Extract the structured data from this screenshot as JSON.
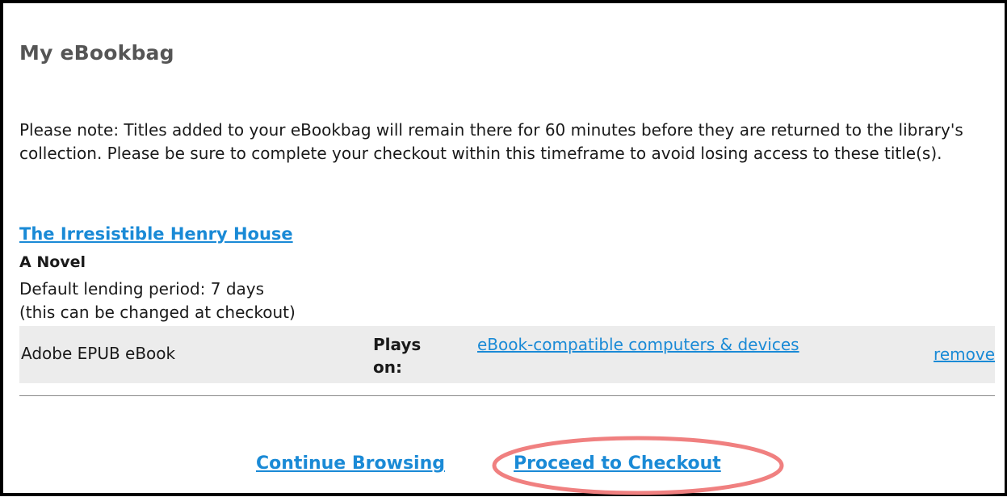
{
  "page": {
    "title": "My eBookbag",
    "note": "Please note: Titles added to your eBookbag will remain there for 60 minutes before they are returned to the library's collection. Please be sure to complete your checkout within this timeframe to avoid losing access to these title(s)."
  },
  "item": {
    "title": "The Irresistible Henry House",
    "subtitle": "A Novel",
    "lending_period": "Default lending period: 7 days",
    "lending_note": "(this can be changed at checkout)",
    "format": "Adobe EPUB eBook",
    "plays_on_label": "Plays on:",
    "devices_link": "eBook-compatible computers & devices",
    "remove_label": "remove"
  },
  "actions": {
    "continue_label": "Continue Browsing",
    "checkout_label": "Proceed to Checkout"
  },
  "colors": {
    "link": "#1a8ad6",
    "highlight": "#f08080",
    "row_bg": "#ececec"
  }
}
